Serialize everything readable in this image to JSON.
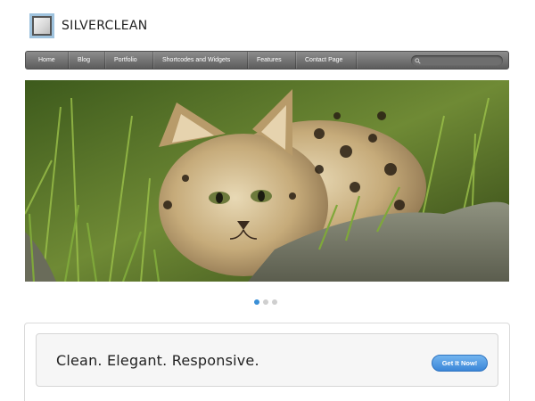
{
  "brand": {
    "name": "SILVERCLEAN",
    "logo_icon": "logo-square-icon"
  },
  "nav": {
    "items": [
      {
        "label": "Home"
      },
      {
        "label": "Blog"
      },
      {
        "label": "Portfolio"
      },
      {
        "label": "Shortcodes and Widgets"
      },
      {
        "label": "Features"
      },
      {
        "label": "Contact Page"
      }
    ],
    "search": {
      "placeholder": "",
      "icon": "search-icon"
    }
  },
  "slider": {
    "image": "serval-kitten-in-grass",
    "pagination": {
      "count": 3,
      "active_index": 0
    }
  },
  "callout": {
    "tagline": "Clean. Elegant. Responsive.",
    "button_label": "Get It Now!"
  },
  "colors": {
    "nav_bg": "#6f6f6f",
    "accent": "#3b86d8",
    "active_dot": "#3a8fd6"
  }
}
